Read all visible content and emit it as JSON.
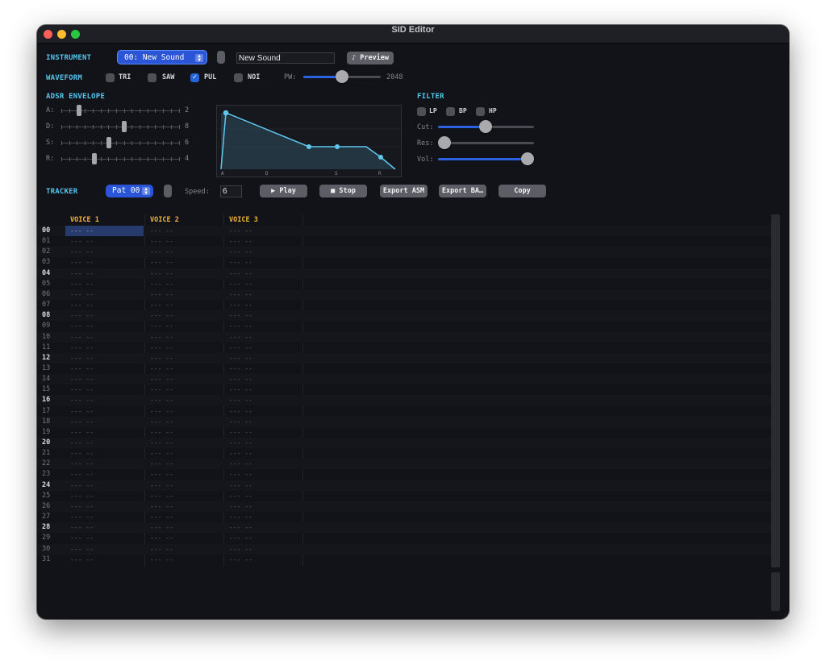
{
  "window": {
    "title": "SID Editor"
  },
  "colors": {
    "accent": "#2a62e0",
    "section": "#54c6ee",
    "voice_header": "#f3b23a",
    "envelope": "#5ec8ee"
  },
  "instrument": {
    "label": "INSTRUMENT",
    "selected": "00: New Sound",
    "name_value": "New Sound",
    "preview_label": "♪ Preview"
  },
  "waveform": {
    "label": "WAVEFORM",
    "options": [
      {
        "label": "TRI",
        "checked": false
      },
      {
        "label": "SAW",
        "checked": false
      },
      {
        "label": "PUL",
        "checked": true
      },
      {
        "label": "NOI",
        "checked": false
      }
    ],
    "pw_label": "PW:",
    "pw_value": "2048"
  },
  "adsr": {
    "label": "ADSR ENVELOPE",
    "params": [
      {
        "label": "A:",
        "value": "2"
      },
      {
        "label": "D:",
        "value": "8"
      },
      {
        "label": "S:",
        "value": "6"
      },
      {
        "label": "R:",
        "value": "4"
      }
    ],
    "graph_labels": [
      "A",
      "D",
      "S",
      "R"
    ]
  },
  "filter": {
    "label": "FILTER",
    "modes": [
      {
        "label": "LP",
        "checked": false
      },
      {
        "label": "BP",
        "checked": false
      },
      {
        "label": "HP",
        "checked": false
      }
    ],
    "cut_label": "Cut:",
    "res_label": "Res:",
    "vol_label": "Vol:"
  },
  "tracker": {
    "label": "TRACKER",
    "pattern": "Pat 00",
    "speed_label": "Speed:",
    "speed_value": "6",
    "play_label": "▶ Play",
    "stop_label": "■ Stop",
    "export_asm_label": "Export ASM",
    "export_basic_label": "Export BA…",
    "copy_label": "Copy",
    "voices": [
      "VOICE 1",
      "VOICE 2",
      "VOICE 3"
    ],
    "empty_cell": "--- --",
    "rows": [
      "00",
      "01",
      "02",
      "03",
      "04",
      "05",
      "06",
      "07",
      "08",
      "09",
      "10",
      "11",
      "12",
      "13",
      "14",
      "15",
      "16",
      "17",
      "18",
      "19",
      "20",
      "21",
      "22",
      "23",
      "24",
      "25",
      "26",
      "27",
      "28",
      "29",
      "30",
      "31"
    ]
  }
}
